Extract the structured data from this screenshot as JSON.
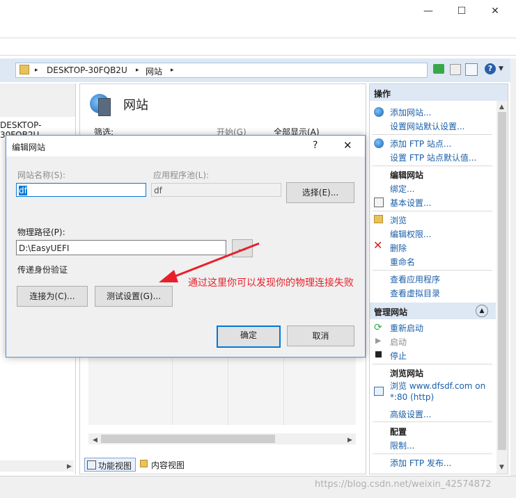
{
  "titlebar": {
    "minimize": "—",
    "maximize": "☐",
    "close": "✕"
  },
  "address": {
    "host": "DESKTOP-30FQB2U",
    "sep": "▸",
    "node": "网站"
  },
  "left_tree": {
    "item": "DESKTOP-30FQB2U"
  },
  "center": {
    "title": "网站",
    "filter_label": "筛选:",
    "start": "开始(G)",
    "show_all": "全部显示(A)",
    "tab_feature": "功能视图",
    "tab_content": "内容视图"
  },
  "actions": {
    "header": "操作",
    "add_site": "添加网站...",
    "site_defaults": "设置网站默认设置...",
    "add_ftp": "添加 FTP 站点...",
    "ftp_defaults": "设置 FTP 站点默认值...",
    "edit_site": "编辑网站",
    "bindings": "绑定...",
    "basic": "基本设置...",
    "browse": "浏览",
    "edit_perms": "编辑权限...",
    "delete": "删除",
    "rename": "重命名",
    "view_apps": "查看应用程序",
    "view_vdirs": "查看虚拟目录",
    "manage_site": "管理网站",
    "restart": "重新启动",
    "start": "启动",
    "stop": "停止",
    "browse_site": "浏览网站",
    "browse_link": "浏览 www.dfsdf.com on",
    "browse_port": "*:80 (http)",
    "advanced": "高级设置...",
    "config": "配置",
    "limits": "限制...",
    "add_ftp_pub": "添加 FTP 发布..."
  },
  "dialog": {
    "title": "编辑网站",
    "help": "?",
    "close": "✕",
    "site_name_label": "网站名称(S):",
    "site_name_value": "df",
    "app_pool_label": "应用程序池(L):",
    "app_pool_value": "df",
    "select_btn": "选择(E)...",
    "path_label": "物理路径(P):",
    "path_value": "D:\\EasyUEFI",
    "browse_btn": "...",
    "auth_label": "传递身份验证",
    "connect_as": "连接为(C)...",
    "test_settings": "测试设置(G)...",
    "ok": "确定",
    "cancel": "取消"
  },
  "annotation": {
    "text": "通过这里你可以发现你的物理连接失败",
    "color": "#e8202a"
  },
  "watermark": "https://blog.csdn.net/weixin_42574872"
}
